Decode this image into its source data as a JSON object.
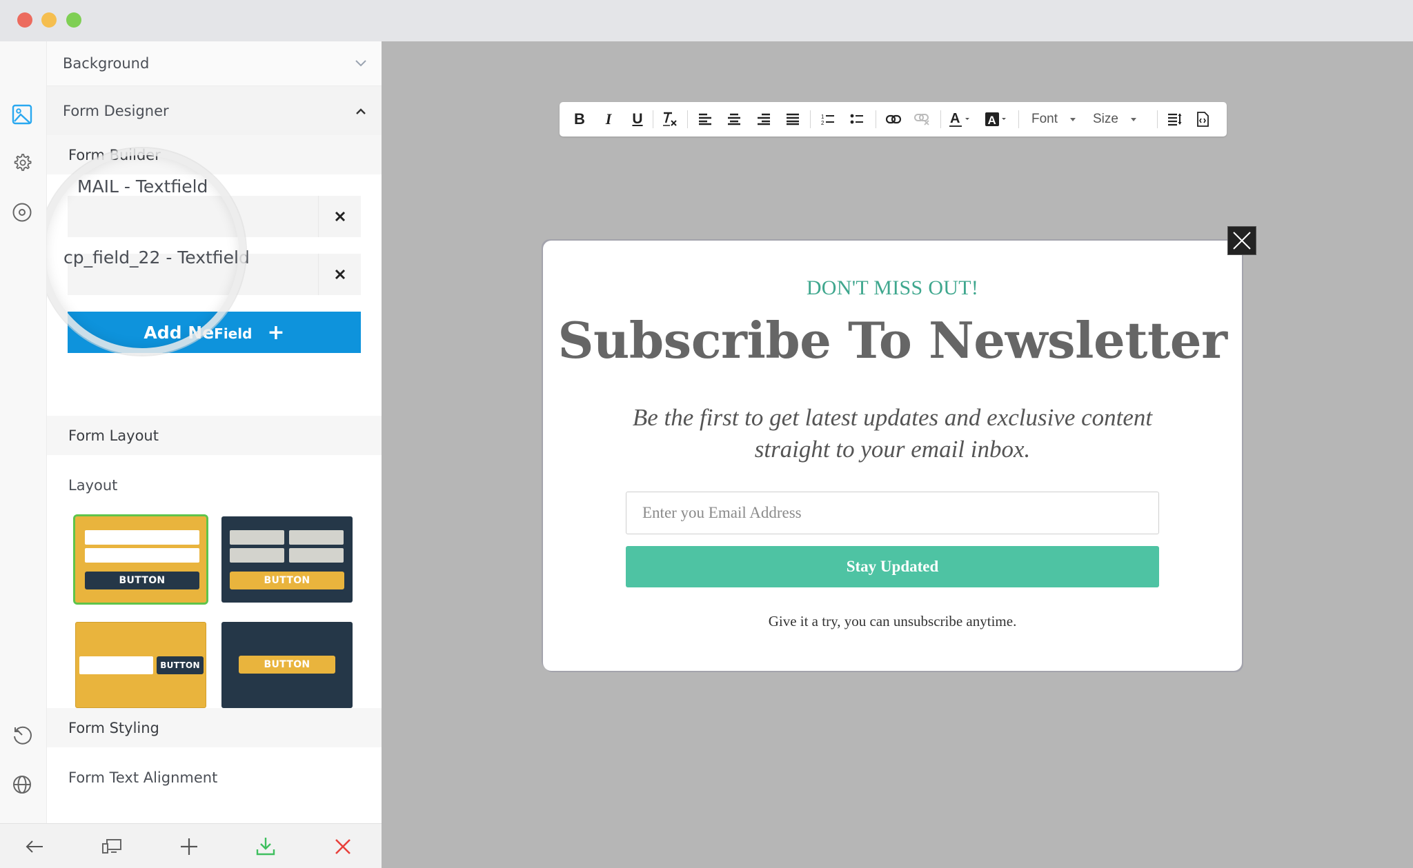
{
  "window": {
    "controls": [
      "close",
      "minimize",
      "maximize"
    ]
  },
  "rail": {
    "top_icons": [
      {
        "name": "image-icon",
        "active": true
      },
      {
        "name": "gear-icon",
        "active": false
      },
      {
        "name": "target-icon",
        "active": false
      }
    ],
    "bottom_icons": [
      {
        "name": "history-icon"
      },
      {
        "name": "globe-icon"
      }
    ]
  },
  "panel": {
    "background_label": "Background",
    "form_designer_label": "Form Designer",
    "form_builder_label": "Form Builder",
    "fields": [
      {
        "label": "MAIL - Textfield",
        "full_label": "EMAIL - Textfield"
      },
      {
        "label": "cp_field_22 - Textfield"
      }
    ],
    "add_field_label": "Add New Field",
    "add_field_label_magnified": "Add Ne",
    "add_field_label_tail": "Field",
    "form_layout_label": "Form Layout",
    "layout_label": "Layout",
    "layouts": [
      {
        "id": "stacked",
        "button_text": "BUTTON",
        "selected": true
      },
      {
        "id": "two-column",
        "button_text": "BUTTON",
        "selected": false
      },
      {
        "id": "inline",
        "button_text": "BUTTON",
        "selected": false
      },
      {
        "id": "button-only",
        "button_text": "BUTTON",
        "selected": false
      }
    ],
    "form_styling_label": "Form Styling",
    "form_text_alignment_label": "Form Text Alignment"
  },
  "bottombar": {
    "buttons": [
      "back-arrow",
      "responsive-preview",
      "add",
      "save-download",
      "close"
    ]
  },
  "toolbar": {
    "font_label": "Font",
    "size_label": "Size"
  },
  "popup": {
    "kicker": "DON'T MISS OUT!",
    "title": "Subscribe To Newsletter",
    "subtitle": "Be the first to get latest updates and exclusive content straight to your email inbox.",
    "email_placeholder": "Enter you Email Address",
    "email_value": "",
    "button_label": "Stay Updated",
    "note": "Give it a try, you can unsubscribe anytime."
  },
  "colors": {
    "accent_blue": "#0e93dc",
    "popup_green": "#4ec3a3",
    "kicker_green": "#3fa78e",
    "layout_yellow": "#e9b43d",
    "layout_navy": "#253748",
    "selected_outline": "#5fc44a",
    "save_green": "#3fbf5f",
    "close_red": "#e8413b"
  }
}
